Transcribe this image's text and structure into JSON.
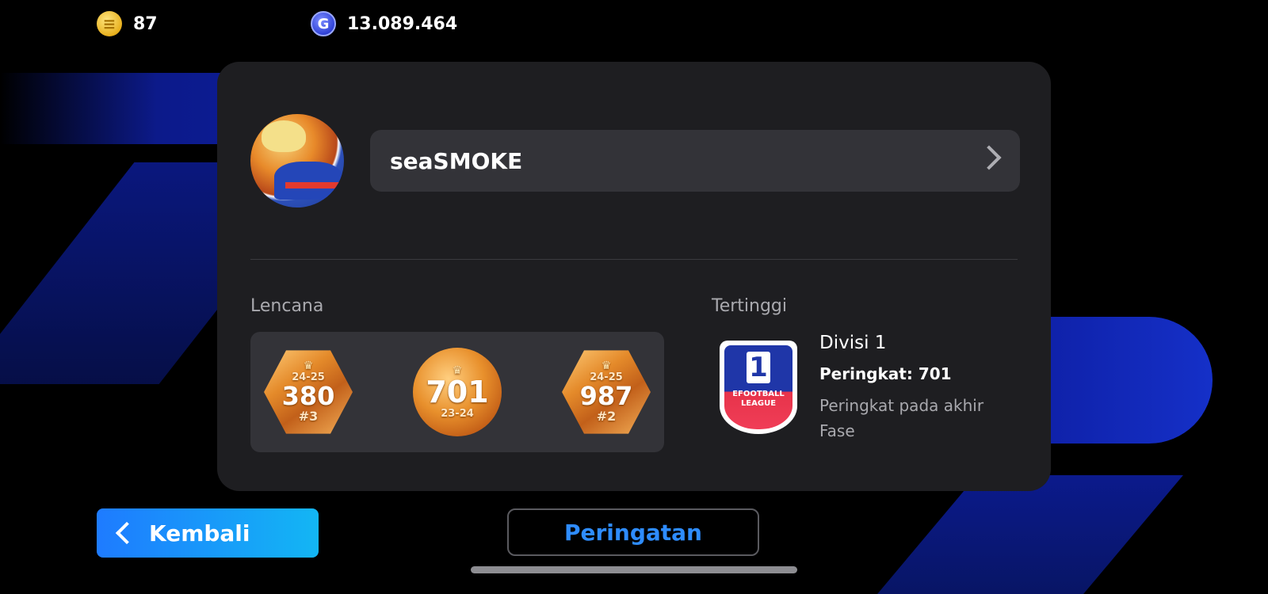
{
  "currency": {
    "coins": "87",
    "gp": "13.089.464",
    "coin_icon": "coin-icon",
    "gp_icon": "gp-icon"
  },
  "profile": {
    "username": "seaSMOKE"
  },
  "badges": {
    "label": "Lencana",
    "items": [
      {
        "season": "24-25",
        "value": "380",
        "rank": "#3"
      },
      {
        "value": "701",
        "season": "23-24"
      },
      {
        "season": "24-25",
        "value": "987",
        "rank": "#2"
      }
    ]
  },
  "highest": {
    "label": "Tertinggi",
    "logo_number": "1",
    "logo_text_line1": "EFOOTBALL",
    "logo_text_line2": "LEAGUE",
    "division": "Divisi 1",
    "rank": "Peringkat: 701",
    "note": "Peringkat pada akhir Fase"
  },
  "buttons": {
    "back": "Kembali",
    "warning": "Peringatan"
  },
  "colors": {
    "accent_blue": "#2e8cff",
    "card_bg": "#1e1e21",
    "panel_bg": "#333338"
  }
}
